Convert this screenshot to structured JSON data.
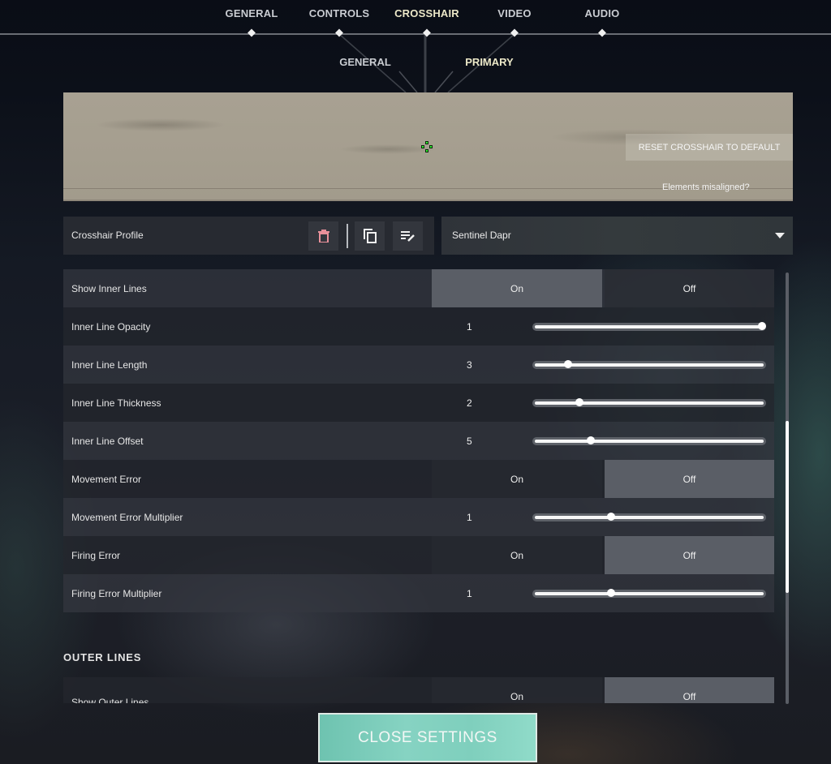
{
  "nav": {
    "tabs": [
      {
        "label": "GENERAL",
        "active": false
      },
      {
        "label": "CONTROLS",
        "active": false
      },
      {
        "label": "CROSSHAIR",
        "active": true
      },
      {
        "label": "VIDEO",
        "active": false
      },
      {
        "label": "AUDIO",
        "active": false
      }
    ],
    "subtabs": [
      {
        "label": "GENERAL",
        "active": false
      },
      {
        "label": "PRIMARY",
        "active": true
      }
    ]
  },
  "preview": {
    "reset_label": "RESET CROSSHAIR TO DEFAULT",
    "misaligned_label": "Elements misaligned?",
    "crosshair_color": "#2df02d"
  },
  "profile": {
    "label": "Crosshair Profile",
    "icons": [
      "trash-icon",
      "copy-icon",
      "edit-list-icon"
    ],
    "selected": "Sentinel Dapr"
  },
  "inner_lines": {
    "rows": [
      {
        "label": "Show Inner Lines",
        "type": "toggle",
        "on_label": "On",
        "off_label": "Off",
        "value": "On"
      },
      {
        "label": "Inner Line Opacity",
        "type": "slider",
        "value": "1",
        "fraction": 1.0
      },
      {
        "label": "Inner Line Length",
        "type": "slider",
        "value": "3",
        "fraction": 0.14
      },
      {
        "label": "Inner Line Thickness",
        "type": "slider",
        "value": "2",
        "fraction": 0.19
      },
      {
        "label": "Inner Line Offset",
        "type": "slider",
        "value": "5",
        "fraction": 0.24
      },
      {
        "label": "Movement Error",
        "type": "toggle",
        "on_label": "On",
        "off_label": "Off",
        "value": "Off"
      },
      {
        "label": "Movement Error Multiplier",
        "type": "slider",
        "value": "1",
        "fraction": 0.33
      },
      {
        "label": "Firing Error",
        "type": "toggle",
        "on_label": "On",
        "off_label": "Off",
        "value": "Off"
      },
      {
        "label": "Firing Error Multiplier",
        "type": "slider",
        "value": "1",
        "fraction": 0.33
      }
    ]
  },
  "outer_lines": {
    "title": "OUTER LINES",
    "rows": [
      {
        "label": "Show Outer Lines",
        "type": "toggle",
        "on_label": "On",
        "off_label": "Off",
        "value": "Off"
      }
    ]
  },
  "scroll": {
    "position_fraction": 0.35,
    "visible_fraction": 0.4
  },
  "close_label": "CLOSE SETTINGS",
  "colors": {
    "accent": "#7fcfbd",
    "active_tab": "#ece8c8"
  }
}
